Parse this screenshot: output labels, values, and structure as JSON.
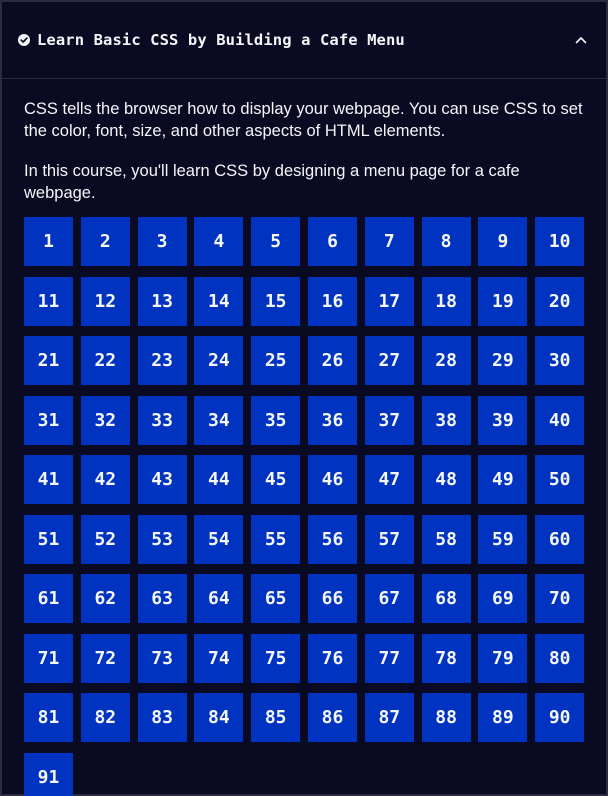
{
  "header": {
    "title": "Learn Basic CSS by Building a Cafe Menu",
    "status_icon": "check-circle-icon",
    "toggle_icon": "chevron-up-icon"
  },
  "description": [
    "CSS tells the browser how to display your webpage. You can use CSS to set the color, font, size, and other aspects of HTML elements.",
    "In this course, you'll learn CSS by designing a menu page for a cafe webpage."
  ],
  "steps": [
    "1",
    "2",
    "3",
    "4",
    "5",
    "6",
    "7",
    "8",
    "9",
    "10",
    "11",
    "12",
    "13",
    "14",
    "15",
    "16",
    "17",
    "18",
    "19",
    "20",
    "21",
    "22",
    "23",
    "24",
    "25",
    "26",
    "27",
    "28",
    "29",
    "30",
    "31",
    "32",
    "33",
    "34",
    "35",
    "36",
    "37",
    "38",
    "39",
    "40",
    "41",
    "42",
    "43",
    "44",
    "45",
    "46",
    "47",
    "48",
    "49",
    "50",
    "51",
    "52",
    "53",
    "54",
    "55",
    "56",
    "57",
    "58",
    "59",
    "60",
    "61",
    "62",
    "63",
    "64",
    "65",
    "66",
    "67",
    "68",
    "69",
    "70",
    "71",
    "72",
    "73",
    "74",
    "75",
    "76",
    "77",
    "78",
    "79",
    "80",
    "81",
    "82",
    "83",
    "84",
    "85",
    "86",
    "87",
    "88",
    "89",
    "90",
    "91"
  ],
  "colors": {
    "background": "#0a0a23",
    "step_tile": "#0033bf",
    "text": "#f5f6f7",
    "border": "#2a2a40"
  }
}
